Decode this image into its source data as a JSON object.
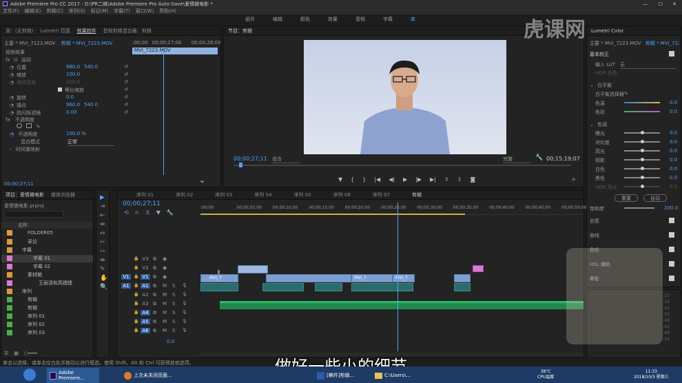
{
  "titlebar": {
    "title": "Adobe Premiere Pro CC 2017 - D:\\PR二维\\Adobe Premiere Pro Auto-Save\\爱情微电影 *"
  },
  "menubar": {
    "items": [
      "文件(F)",
      "编辑(E)",
      "剪辑(C)",
      "序列(S)",
      "标记(M)",
      "字幕(T)",
      "窗口(W)",
      "帮助(H)"
    ]
  },
  "workspaces": {
    "items": [
      "组件",
      "编辑",
      "颜色",
      "效果",
      "音频",
      "字幕",
      "库"
    ]
  },
  "effect_controls": {
    "tabs": [
      "源：(无剪辑)",
      "Lumetri 范围",
      "效果控件",
      "音频剪辑混合器：剪辑"
    ],
    "master": "主要 * MVI_7223.MOV",
    "clip": "剪辑 * MVI_7223.MOV",
    "timecode_a": ";00;00",
    "timecode_b": "00;00;27;00",
    "timecode_c": "00;00;28;00",
    "clip_bar": "MVI_7223.MOV",
    "section_video": "视频效果",
    "motion": "运动",
    "props": [
      {
        "name": "位置",
        "v1": "960.0",
        "v2": "540.0"
      },
      {
        "name": "缩放",
        "v1": "100.0",
        "v2": ""
      },
      {
        "name": "缩放宽度",
        "v1": "100.0",
        "v2": ""
      },
      {
        "name": "等比缩放",
        "v1": "",
        "v2": ""
      },
      {
        "name": "旋转",
        "v1": "0.0",
        "v2": ""
      },
      {
        "name": "锚点",
        "v1": "960.0",
        "v2": "540.0"
      },
      {
        "name": "防闪烁滤镜",
        "v1": "0.00",
        "v2": ""
      }
    ],
    "opacity": "不透明度",
    "opacity_prop": "不透明度",
    "opacity_val": "100.0 %",
    "blend": "混合模式",
    "blend_val": "正常",
    "time_remap": "时间重映射",
    "timecode_bottom": "00;00;27;11"
  },
  "program": {
    "title": "节目：剪辑",
    "timecode": "00;00;27;11",
    "fit": "适合",
    "quality": "完整",
    "duration": "00;15;19;07"
  },
  "lumetri": {
    "title": "Lumetri Color",
    "master": "主要 * MVI_7223.MOV",
    "clip": "剪辑 * MVI_7223.MOV",
    "basic": "基本校正",
    "lut_label": "输入 LUT",
    "lut_val": "无",
    "hdr": "HDR 白色",
    "wb": "白平衡",
    "wb_picker": "白平衡选择器",
    "temp": "色温",
    "tint": "色彩",
    "tone": "色调",
    "exposure": "曝光",
    "contrast": "对比度",
    "highlights": "高光",
    "shadows": "阴影",
    "whites": "白色",
    "blacks": "黑色",
    "hdr_spec": "HDR 高光",
    "zero": "0.0",
    "reset": "重置",
    "auto": "自动",
    "saturation": "饱和度",
    "sat_val": "100.0",
    "creative": "创意",
    "curves": "曲线",
    "color_wheels": "色轮",
    "hsl": "HSL 辅助",
    "vignette": "晕影"
  },
  "project": {
    "tabs": [
      "项目：爱情微电影",
      "媒体浏览器"
    ],
    "file": "爱情微电影.prproj",
    "col_name": "名称",
    "items": [
      {
        "name": "FOLDER05",
        "color": "#d89a40",
        "indent": 2
      },
      {
        "name": "采访",
        "color": "#d89a40",
        "indent": 2
      },
      {
        "name": "字幕",
        "color": "#d89a40",
        "indent": 1
      },
      {
        "name": "字幕 01",
        "color": "#d77bd0",
        "indent": 3
      },
      {
        "name": "字幕 02",
        "color": "#d77bd0",
        "indent": 3
      },
      {
        "name": "素材箱",
        "color": "#d89a40",
        "indent": 2
      },
      {
        "name": "王丽清和芮婕婕",
        "color": "#d77bd0",
        "indent": 4
      },
      {
        "name": "序列",
        "color": "#d89a40",
        "indent": 1
      },
      {
        "name": "剪辑",
        "color": "#4cae4c",
        "indent": 2
      },
      {
        "name": "剪辑",
        "color": "#4cae4c",
        "indent": 2
      },
      {
        "name": "序列 01",
        "color": "#4cae4c",
        "indent": 2
      },
      {
        "name": "序列 02",
        "color": "#4cae4c",
        "indent": 2
      },
      {
        "name": "序列 03",
        "color": "#4cae4c",
        "indent": 2
      }
    ]
  },
  "timeline": {
    "tabs": [
      "序列 01",
      "序列 02",
      "序列 03",
      "序列 04",
      "序列 05",
      "序列 06",
      "序列 07",
      "剪辑"
    ],
    "timecode": "00;00;27;11",
    "ruler": [
      ":00;00",
      "00;00;05;00",
      "00;00;10;00",
      "00;00;15;00",
      "00;00;20;00",
      "00;00;25;00",
      "00;00;30;00",
      "00;00;35;00",
      "00;00;40;00",
      "00;00;45;00",
      "00;00;50;00"
    ],
    "tracks_video": [
      "V3",
      "V2",
      "V1"
    ],
    "tracks_audio": [
      "A1",
      "A2",
      "A3",
      "A4",
      "A5",
      "A6"
    ],
    "master_val": "0.0",
    "clip_labels": [
      "MVI_7",
      "MVI_7",
      "MVI_7"
    ]
  },
  "statusbar": {
    "text": "单击以选择，或单击空白处并拖动以进行框选。使用 Shift、Alt 和 Ctrl 可获得其他选项。"
  },
  "subtitle": "做好一些小的细节",
  "watermark": "虎课网",
  "taskbar": {
    "apps": [
      "Adobe Premiere...",
      "上次未关闭页面...",
      "[稿件]剪辑...",
      "C:\\Users\\..."
    ],
    "temp": "38°C",
    "temp_label": "CPU温度",
    "time": "11:33",
    "date": "2018/10/3 星期三"
  },
  "colors": {
    "accent": "#4fa3f7",
    "video_clip": "#7c9fd0",
    "audio_clip": "#2a6c6c",
    "green_audio": "#2fb86a",
    "playhead": "#4fa3f7"
  }
}
